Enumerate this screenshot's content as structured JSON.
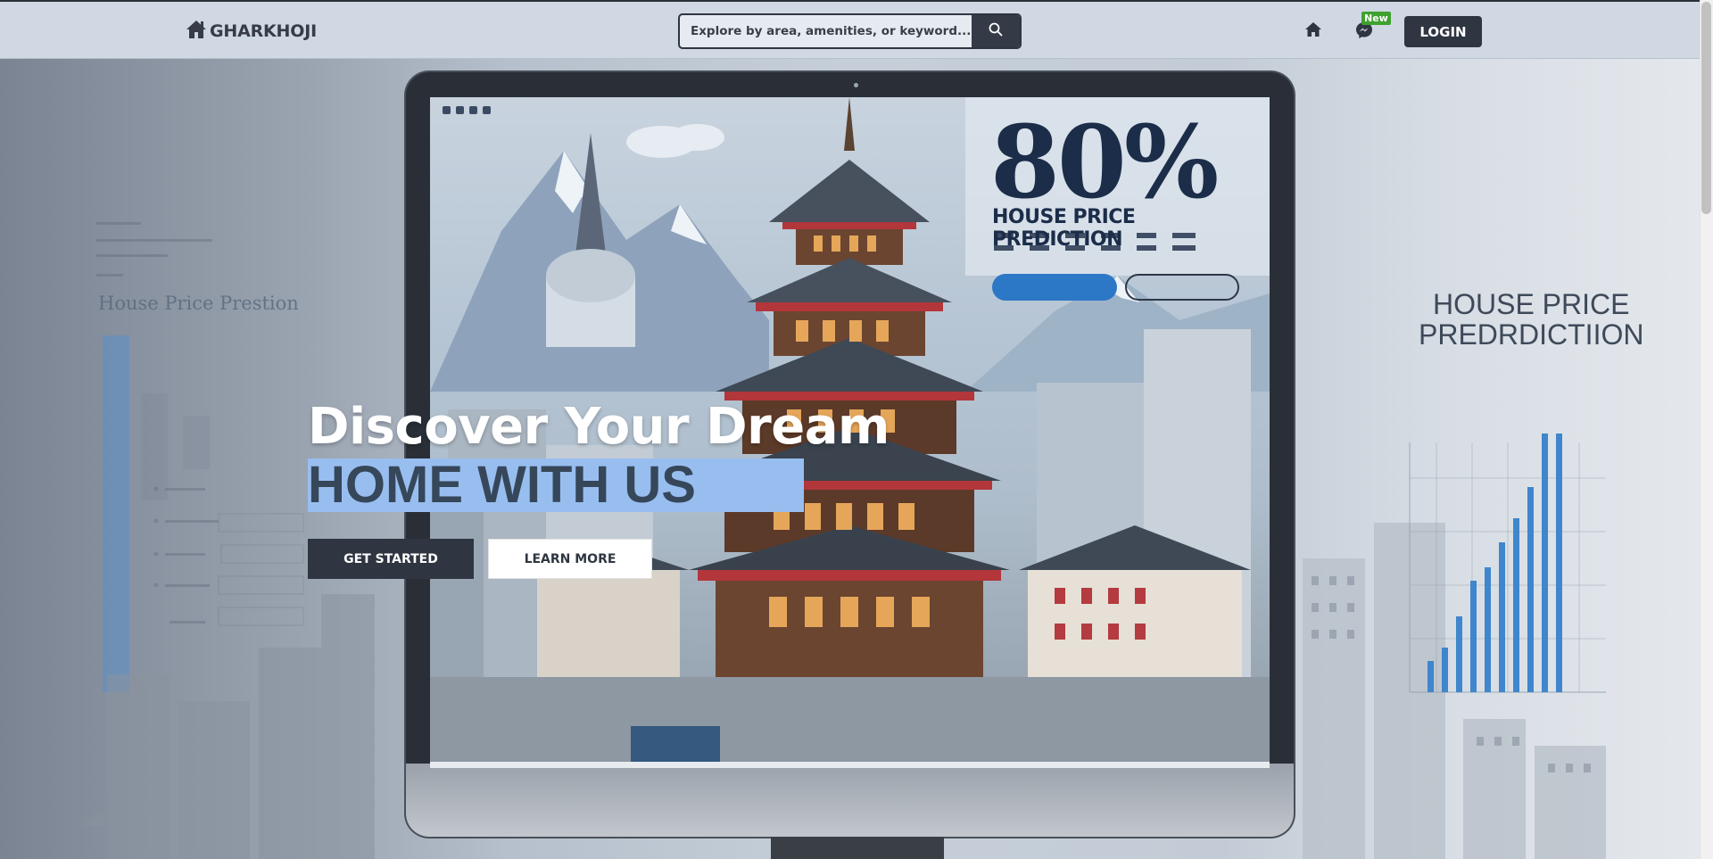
{
  "nav": {
    "brand": "GHARKHOJI",
    "search_placeholder": "Explore by area, amenities, or keyword...",
    "badge": "New",
    "login_label": "LOGIN"
  },
  "hero": {
    "heading_line1": "Discover Your Dream",
    "heading_line2": "HOME WITH US",
    "get_started_label": "GET STARTED",
    "learn_more_label": "LEARN MORE"
  },
  "background_art": {
    "screen_percent": "80%",
    "screen_title": "HOUSE PRICE PREDICTION",
    "left_card_title": "House Price Prestion",
    "right_title_line1": "HOUSE PRICE",
    "right_title_line2": "PREDRDICTIION"
  },
  "colors": {
    "nav_bg": "#cfd8e3",
    "dark": "#2f3541",
    "selection": "#98bef0",
    "new_badge": "#3fa12f"
  },
  "icons": [
    "home-logo-icon",
    "search-icon",
    "home-icon",
    "messenger-icon"
  ]
}
